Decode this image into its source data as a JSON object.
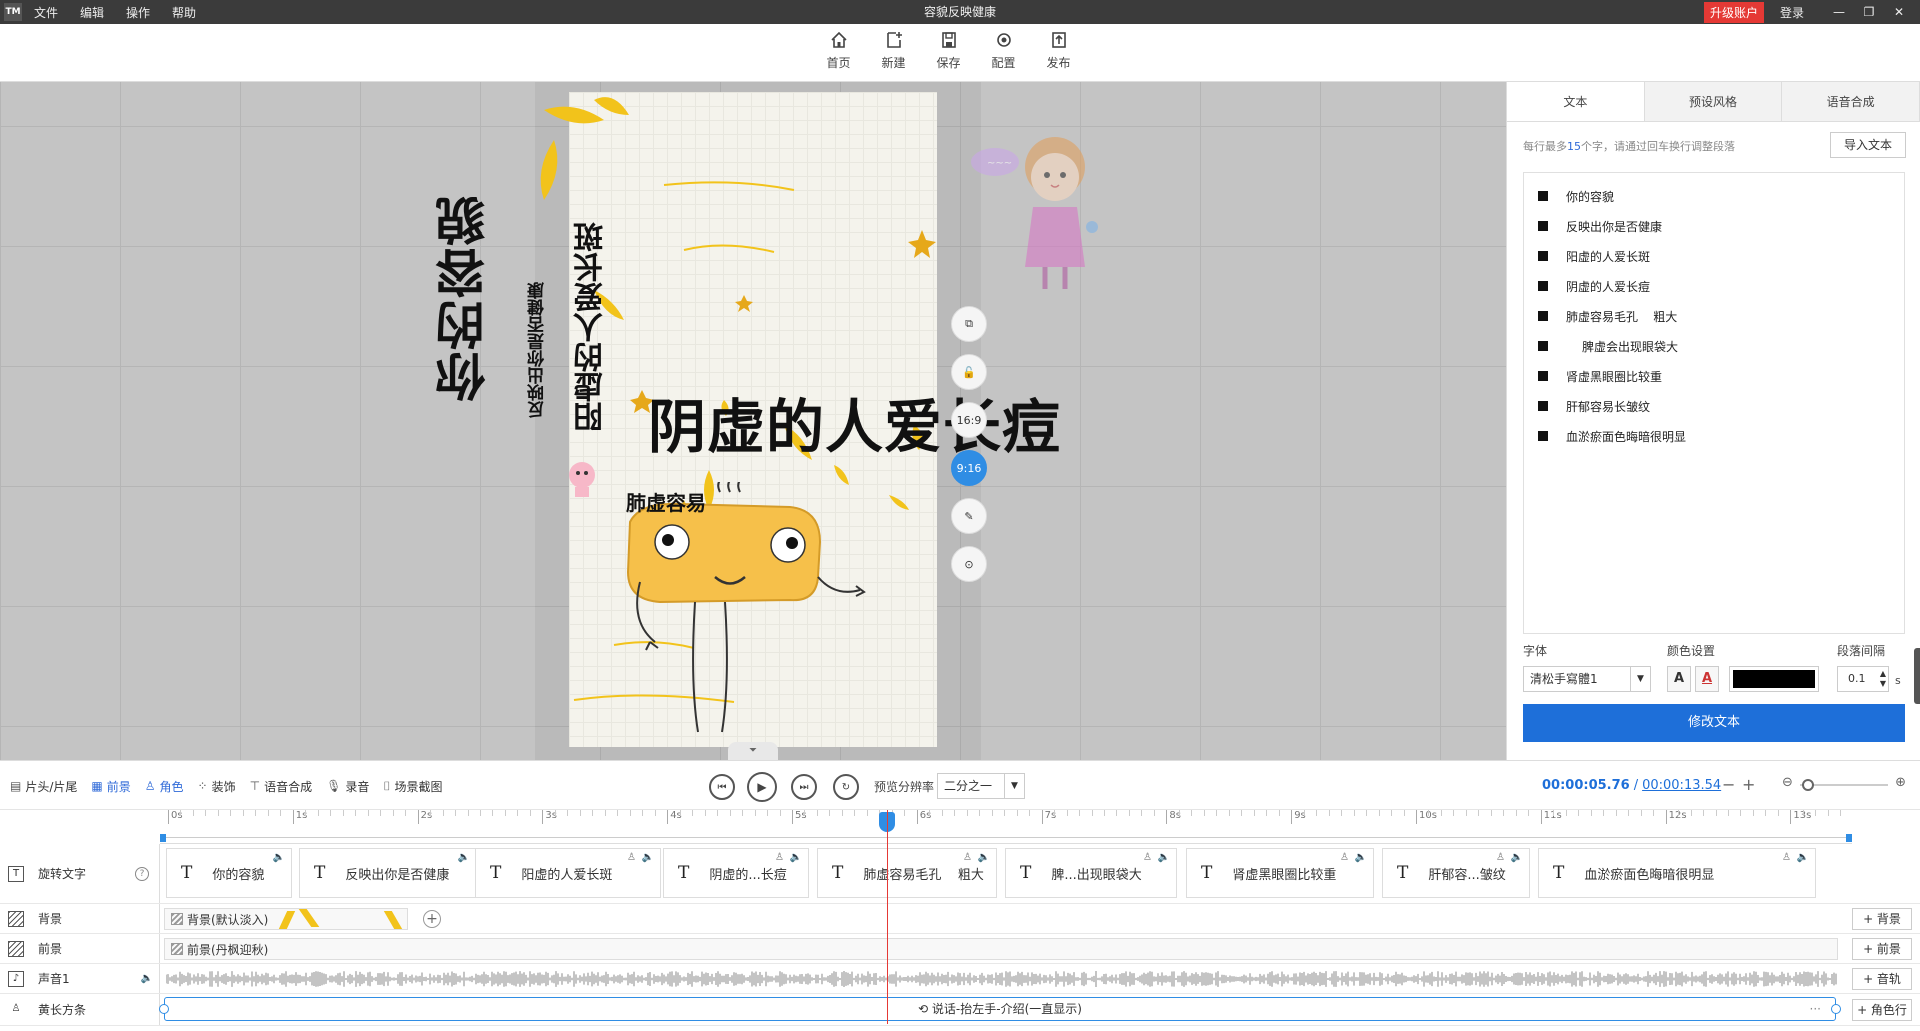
{
  "titlebar": {
    "logo": "TM",
    "menu": [
      "文件",
      "编辑",
      "操作",
      "帮助"
    ],
    "title": "容貌反映健康",
    "upgrade": "升级账户",
    "login": "登录",
    "controls": [
      "—",
      "❐",
      "✕"
    ]
  },
  "toolbar": {
    "items": [
      {
        "label": "首页",
        "icon": "home-icon"
      },
      {
        "label": "新建",
        "icon": "new-file-icon"
      },
      {
        "label": "保存",
        "icon": "save-icon"
      },
      {
        "label": "配置",
        "icon": "settings-icon"
      },
      {
        "label": "发布",
        "icon": "publish-icon"
      }
    ]
  },
  "canvas": {
    "texts": {
      "rongmao": "你的容貌",
      "fanying": "反映出你是否健康",
      "yangxu": "阳虚的人爱长斑",
      "yinxu": "阴虚的人爱长痘",
      "feixu": "肺虚容易"
    },
    "float_buttons": [
      {
        "name": "copy-icon",
        "label": "⧉"
      },
      {
        "name": "lock-icon",
        "label": "🔓"
      },
      {
        "name": "ratio-16-9",
        "label": "16:9"
      },
      {
        "name": "ratio-9-16",
        "label": "9:16"
      },
      {
        "name": "edit-icon",
        "label": "✎"
      },
      {
        "name": "settings-icon",
        "label": "⊙"
      }
    ]
  },
  "right_panel": {
    "tabs": [
      "文本",
      "预设风格",
      "语音合成"
    ],
    "active_tab": "文本",
    "hint_pre": "每行最多",
    "hint_num": "15",
    "hint_post": "个字，请通过回车换行调整段落",
    "import_button": "导入文本",
    "lines": [
      "你的容貌",
      "反映出你是否健康",
      "阳虚的人爱长斑",
      "阴虚的人爱长痘",
      "肺虚容易毛孔    粗大",
      "脾虚会出现眼袋大",
      "肾虚黑眼圈比较重",
      "肝郁容易长皱纹",
      "血淤瘀面色晦暗很明显"
    ],
    "font_label": "字体",
    "font_value": "清松手寫體1",
    "color_label": "颜色设置",
    "color_btn_a1": "A",
    "color_btn_a2": "A",
    "color_value": "#000000",
    "spacing_label": "段落间隔",
    "spacing_value": "0.1",
    "spacing_unit": "s",
    "modify_button": "修改文本"
  },
  "controls": {
    "left_tools": [
      {
        "label": "片头/片尾",
        "icon": "film-icon",
        "active": false
      },
      {
        "label": "前景",
        "icon": "foreground-icon",
        "active": true
      },
      {
        "label": "角色",
        "icon": "person-icon",
        "active": true
      },
      {
        "label": "装饰",
        "icon": "decoration-icon",
        "active": false
      },
      {
        "label": "语音合成",
        "icon": "tts-icon",
        "active": false
      },
      {
        "label": "录音",
        "icon": "mic-icon",
        "active": false
      },
      {
        "label": "场景截图",
        "icon": "camera-icon",
        "active": false
      }
    ],
    "resolution_label": "预览分辨率",
    "resolution_value": "二分之一",
    "current_time": "00:00:05.76",
    "time_sep": "/",
    "total_time": "00:00:13.54"
  },
  "timeline": {
    "ruler_labels": [
      "0s",
      "1s",
      "2s",
      "3s",
      "4s",
      "5s",
      "6s",
      "7s",
      "8s",
      "9s",
      "10s",
      "11s",
      "12s",
      "13s"
    ],
    "playhead_seconds": 5.76,
    "total_seconds": 13.54,
    "tracks": {
      "text": {
        "label": "旋转文字",
        "help": "?"
      },
      "background": {
        "label": "背景",
        "clip": "背景(默认淡入)",
        "add": "+ 背景"
      },
      "foreground": {
        "label": "前景",
        "clip": "前景(丹枫迎秋)",
        "add": "+ 前景"
      },
      "audio": {
        "label": "声音1",
        "add": "+ 音轨"
      },
      "role": {
        "label": "黄长方条",
        "clip": "说话-抬左手-介绍(一直显示)",
        "add": "+ 角色行"
      }
    },
    "text_clips": [
      "你的容貌",
      "反映出你是否健康",
      "阳虚的人爱长斑",
      "阴虚的...长痘",
      "肺虚容易毛孔    粗大",
      "脾...出现眼袋大",
      "肾虚黑眼圈比较重",
      "肝郁容...皱纹",
      "血淤瘀面色晦暗很明显"
    ]
  },
  "colors": {
    "accent": "#2f8de4",
    "primary_button": "#1e6fd9",
    "upgrade": "#e53935",
    "playhead": "#e53935",
    "titlebar": "#3b3b3b"
  }
}
